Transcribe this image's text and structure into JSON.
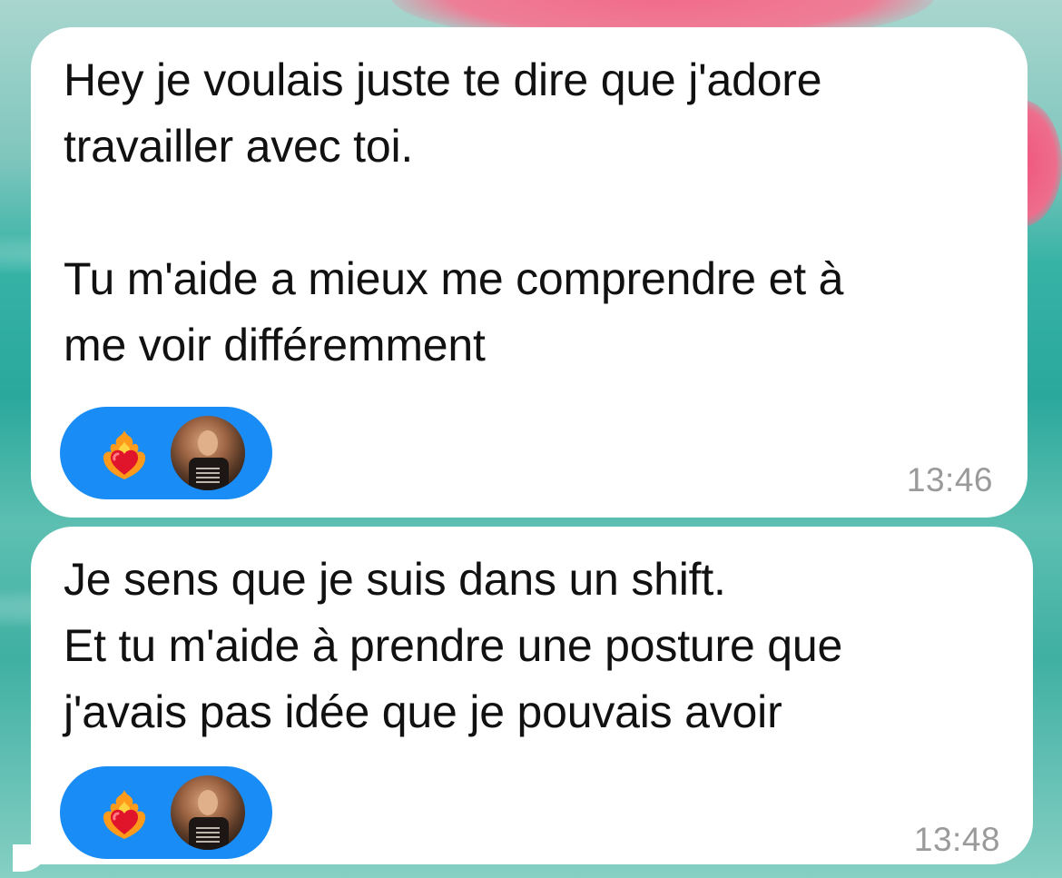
{
  "messages": [
    {
      "text": "Hey je voulais juste te dire que j'adore\ntravailler avec toi.\n\nTu m'aide a mieux me comprendre et à\nme voir différemment",
      "time": "13:46",
      "reactions": [
        {
          "icon": "heart-on-fire-icon"
        },
        {
          "icon": "avatar"
        }
      ]
    },
    {
      "text": "Je sens que je suis dans un shift.\nEt tu m'aide à prendre une posture que\nj'avais pas idée que je pouvais avoir",
      "time": "13:48",
      "reactions": [
        {
          "icon": "heart-on-fire-icon"
        },
        {
          "icon": "avatar"
        }
      ]
    }
  ],
  "colors": {
    "bubble_bg": "#ffffff",
    "reaction_pill": "#1a8cf5",
    "timestamp": "#9a9a9a",
    "text": "#111111"
  }
}
